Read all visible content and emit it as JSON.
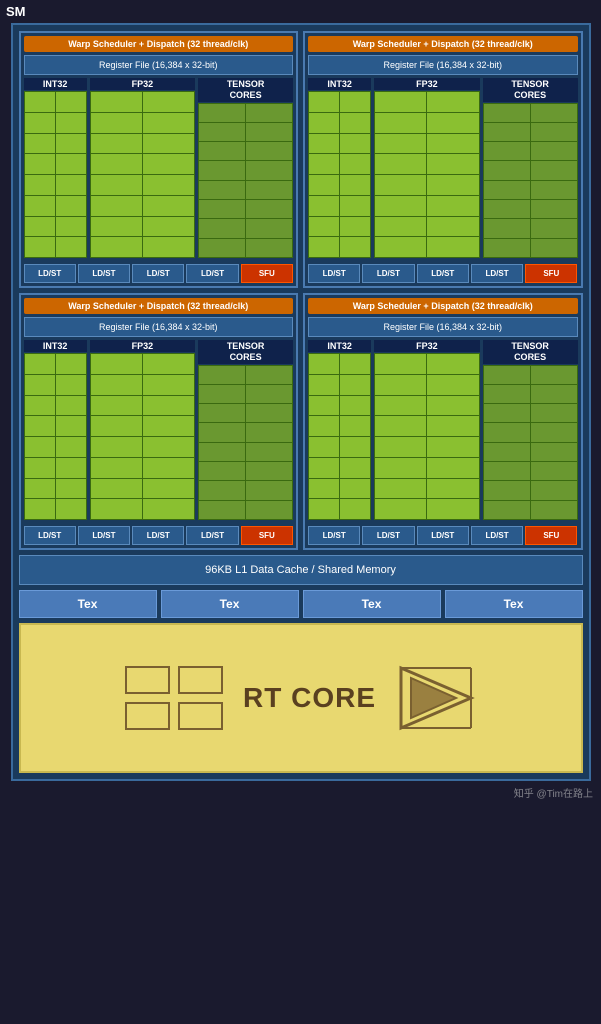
{
  "sm_label": "SM",
  "warp_scheduler": "Warp Scheduler + Dispatch (32 thread/clk)",
  "register_file": "Register File (16,384 x 32-bit)",
  "int32_label": "INT32",
  "fp32_label": "FP32",
  "tensor_label": "TENSOR\nCORES",
  "ld_st_label": "LD/ST",
  "sfu_label": "SFU",
  "cache_label": "96KB L1 Data Cache / Shared Memory",
  "tex_label": "Tex",
  "rt_core_label": "RT CORE",
  "watermark": "知乎 @Tim在路上",
  "quadrants": [
    {
      "id": "q1"
    },
    {
      "id": "q2"
    },
    {
      "id": "q3"
    },
    {
      "id": "q4"
    }
  ]
}
